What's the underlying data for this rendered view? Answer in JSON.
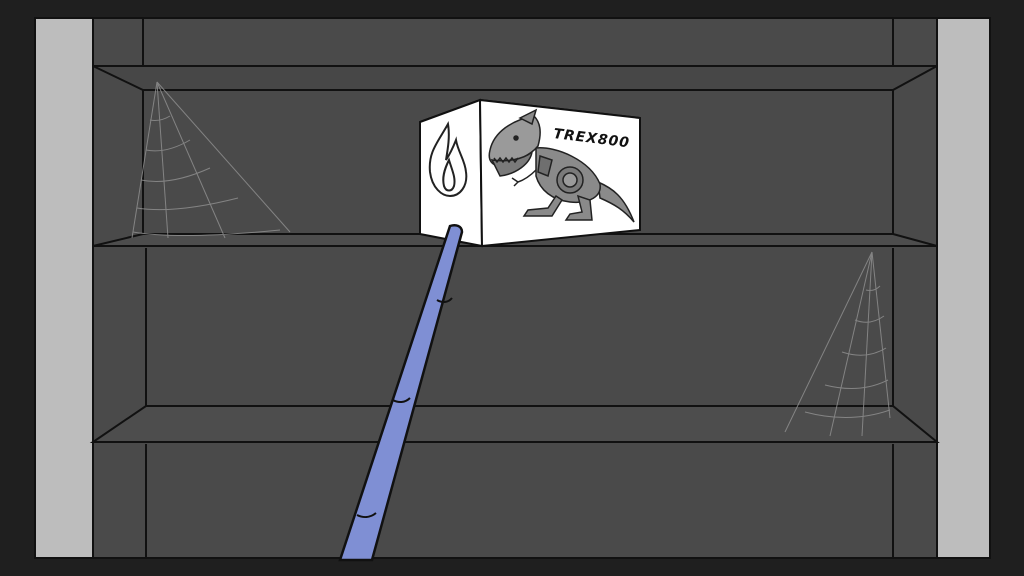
{
  "colors": {
    "background": "#1f1f1f",
    "wall": "#4a4a4a",
    "side_panel": "#bdbdbd",
    "outline": "#111111",
    "box": "#ffffff",
    "dinosaur": "#8a8a8a",
    "cobweb": "#9a9a9a",
    "pole": "#7f8fd4"
  },
  "box": {
    "brand_label": "TREX800",
    "side_icon": "flame-icon",
    "front_image": "robot-trex"
  }
}
